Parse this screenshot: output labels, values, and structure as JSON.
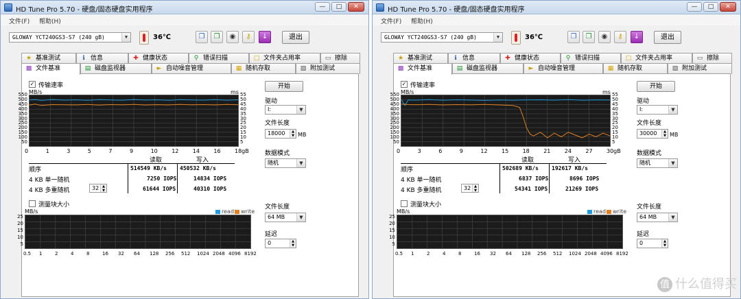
{
  "app": {
    "title": "HD Tune Pro 5.70 - 硬盘/固态硬盘实用程序"
  },
  "menu": {
    "file": "文件(F)",
    "help": "帮助(H)"
  },
  "toolbar": {
    "temperature": "36℃",
    "exit": "退出"
  },
  "tabs_row1": [
    "基准测试",
    "信息",
    "健康状态",
    "错误扫描",
    "文件夹占用率",
    "擦除"
  ],
  "tabs_row2": [
    "文件基准",
    "磁盘监视器",
    "自动噪音管理",
    "随机存取",
    "附加测试"
  ],
  "labels": {
    "transfer_rate": "传输速率",
    "mbs": "MB/s",
    "ms": "ms",
    "start": "开始",
    "drive": "驱动",
    "file_length": "文件长度",
    "mb": "MB",
    "data_pattern": "数据模式",
    "read": "读取",
    "write": "写入",
    "sequential": "顺序",
    "rand_single": "4 KB 单一随机",
    "rand_multi": "4 KB 多重随机",
    "queue": "32",
    "block_size": "测量块大小",
    "legend_read": "read",
    "legend_write": "write",
    "latency": "延迟",
    "latency_value": "0",
    "block_file_length": "64 MB"
  },
  "colors": {
    "read": "#1e9be0",
    "write": "#e0801e"
  },
  "block_axis": {
    "y_ticks": [
      "25",
      "20",
      "15",
      "10",
      "5"
    ],
    "x_ticks": [
      "0.5",
      "1",
      "2",
      "4",
      "8",
      "16",
      "32",
      "64",
      "128",
      "256",
      "512",
      "1024",
      "2048",
      "4096",
      "8192"
    ]
  },
  "windows": [
    {
      "drive": "GLOWAY  YCT240GS3-S7  (240 gB)",
      "drive_letter": "I:",
      "file_length": "18000",
      "pattern": "随机",
      "seq_read": "514549 KB/s",
      "seq_write": "450532 KB/s",
      "single_read": "7250 IOPS",
      "single_write": "14834 IOPS",
      "multi_read": "61644 IOPS",
      "multi_write": "40310 IOPS",
      "x_ticks": [
        "0",
        "1",
        "3",
        "5",
        "7",
        "9",
        "10",
        "12",
        "14",
        "16",
        "18gB"
      ],
      "y_left": [
        "550",
        "500",
        "450",
        "400",
        "350",
        "300",
        "250",
        "200",
        "150",
        "100",
        "50"
      ],
      "y_right": [
        "55",
        "50",
        "45",
        "40",
        "35",
        "30",
        "25",
        "20",
        "15",
        "10",
        "5"
      ],
      "chart_data": {
        "type": "line",
        "xlabel": "gB",
        "x_range": [
          0,
          18
        ],
        "ylim": [
          0,
          550
        ],
        "series": [
          {
            "name": "read",
            "x": [
              0,
              0.5,
              1,
              2,
              3,
              4,
              5,
              6,
              7,
              8,
              9,
              10,
              11,
              12,
              13,
              14,
              15,
              16,
              17,
              18
            ],
            "values": [
              500,
              505,
              495,
              505,
              498,
              502,
              496,
              504,
              500,
              497,
              505,
              499,
              502,
              496,
              504,
              500,
              498,
              503,
              497,
              502
            ]
          },
          {
            "name": "write",
            "x": [
              0,
              0.5,
              1,
              2,
              3,
              4,
              5,
              6,
              7,
              8,
              9,
              10,
              11,
              12,
              13,
              14,
              15,
              16,
              17,
              18
            ],
            "values": [
              445,
              455,
              440,
              450,
              448,
              446,
              452,
              444,
              450,
              447,
              451,
              445,
              449,
              446,
              452,
              447,
              450,
              446,
              451,
              448
            ]
          }
        ]
      }
    },
    {
      "drive": "GLOWAY  YCT240GS3-S7  (240 gB)",
      "drive_letter": "I:",
      "file_length": "30000",
      "pattern": "随机",
      "seq_read": "502689 KB/s",
      "seq_write": "192617 KB/s",
      "single_read": "6837 IOPS",
      "single_write": "8696 IOPS",
      "multi_read": "54341 IOPS",
      "multi_write": "21269 IOPS",
      "x_ticks": [
        "0",
        "3",
        "6",
        "9",
        "12",
        "15",
        "18",
        "21",
        "24",
        "27",
        "30gB"
      ],
      "y_left": [
        "550",
        "500",
        "450",
        "400",
        "350",
        "300",
        "250",
        "200",
        "150",
        "100",
        "50"
      ],
      "y_right": [
        "55",
        "50",
        "45",
        "40",
        "35",
        "30",
        "25",
        "20",
        "15",
        "10",
        "5"
      ],
      "chart_data": {
        "type": "line",
        "xlabel": "gB",
        "x_range": [
          0,
          30
        ],
        "ylim": [
          0,
          550
        ],
        "series": [
          {
            "name": "read",
            "x": [
              0,
              0.5,
              1,
              2,
              4,
              6,
              8,
              10,
              12,
              14,
              16,
              18,
              20,
              22,
              24,
              26,
              28,
              30
            ],
            "values": [
              505,
              440,
              500,
              498,
              503,
              497,
              502,
              499,
              495,
              500,
              497,
              500,
              502,
              498,
              503,
              497,
              501,
              499
            ]
          },
          {
            "name": "write",
            "x": [
              0,
              1,
              2,
              4,
              6,
              8,
              10,
              12,
              14,
              16,
              17,
              17.5,
              18,
              18.5,
              19,
              20,
              21,
              22,
              23,
              24,
              25,
              26,
              27,
              28,
              29,
              30
            ],
            "values": [
              455,
              450,
              448,
              452,
              446,
              450,
              447,
              451,
              446,
              440,
              420,
              320,
              200,
              130,
              110,
              150,
              90,
              140,
              100,
              150,
              120,
              90,
              130,
              100,
              140,
              110
            ]
          }
        ]
      }
    }
  ],
  "watermark": "什么值得买"
}
